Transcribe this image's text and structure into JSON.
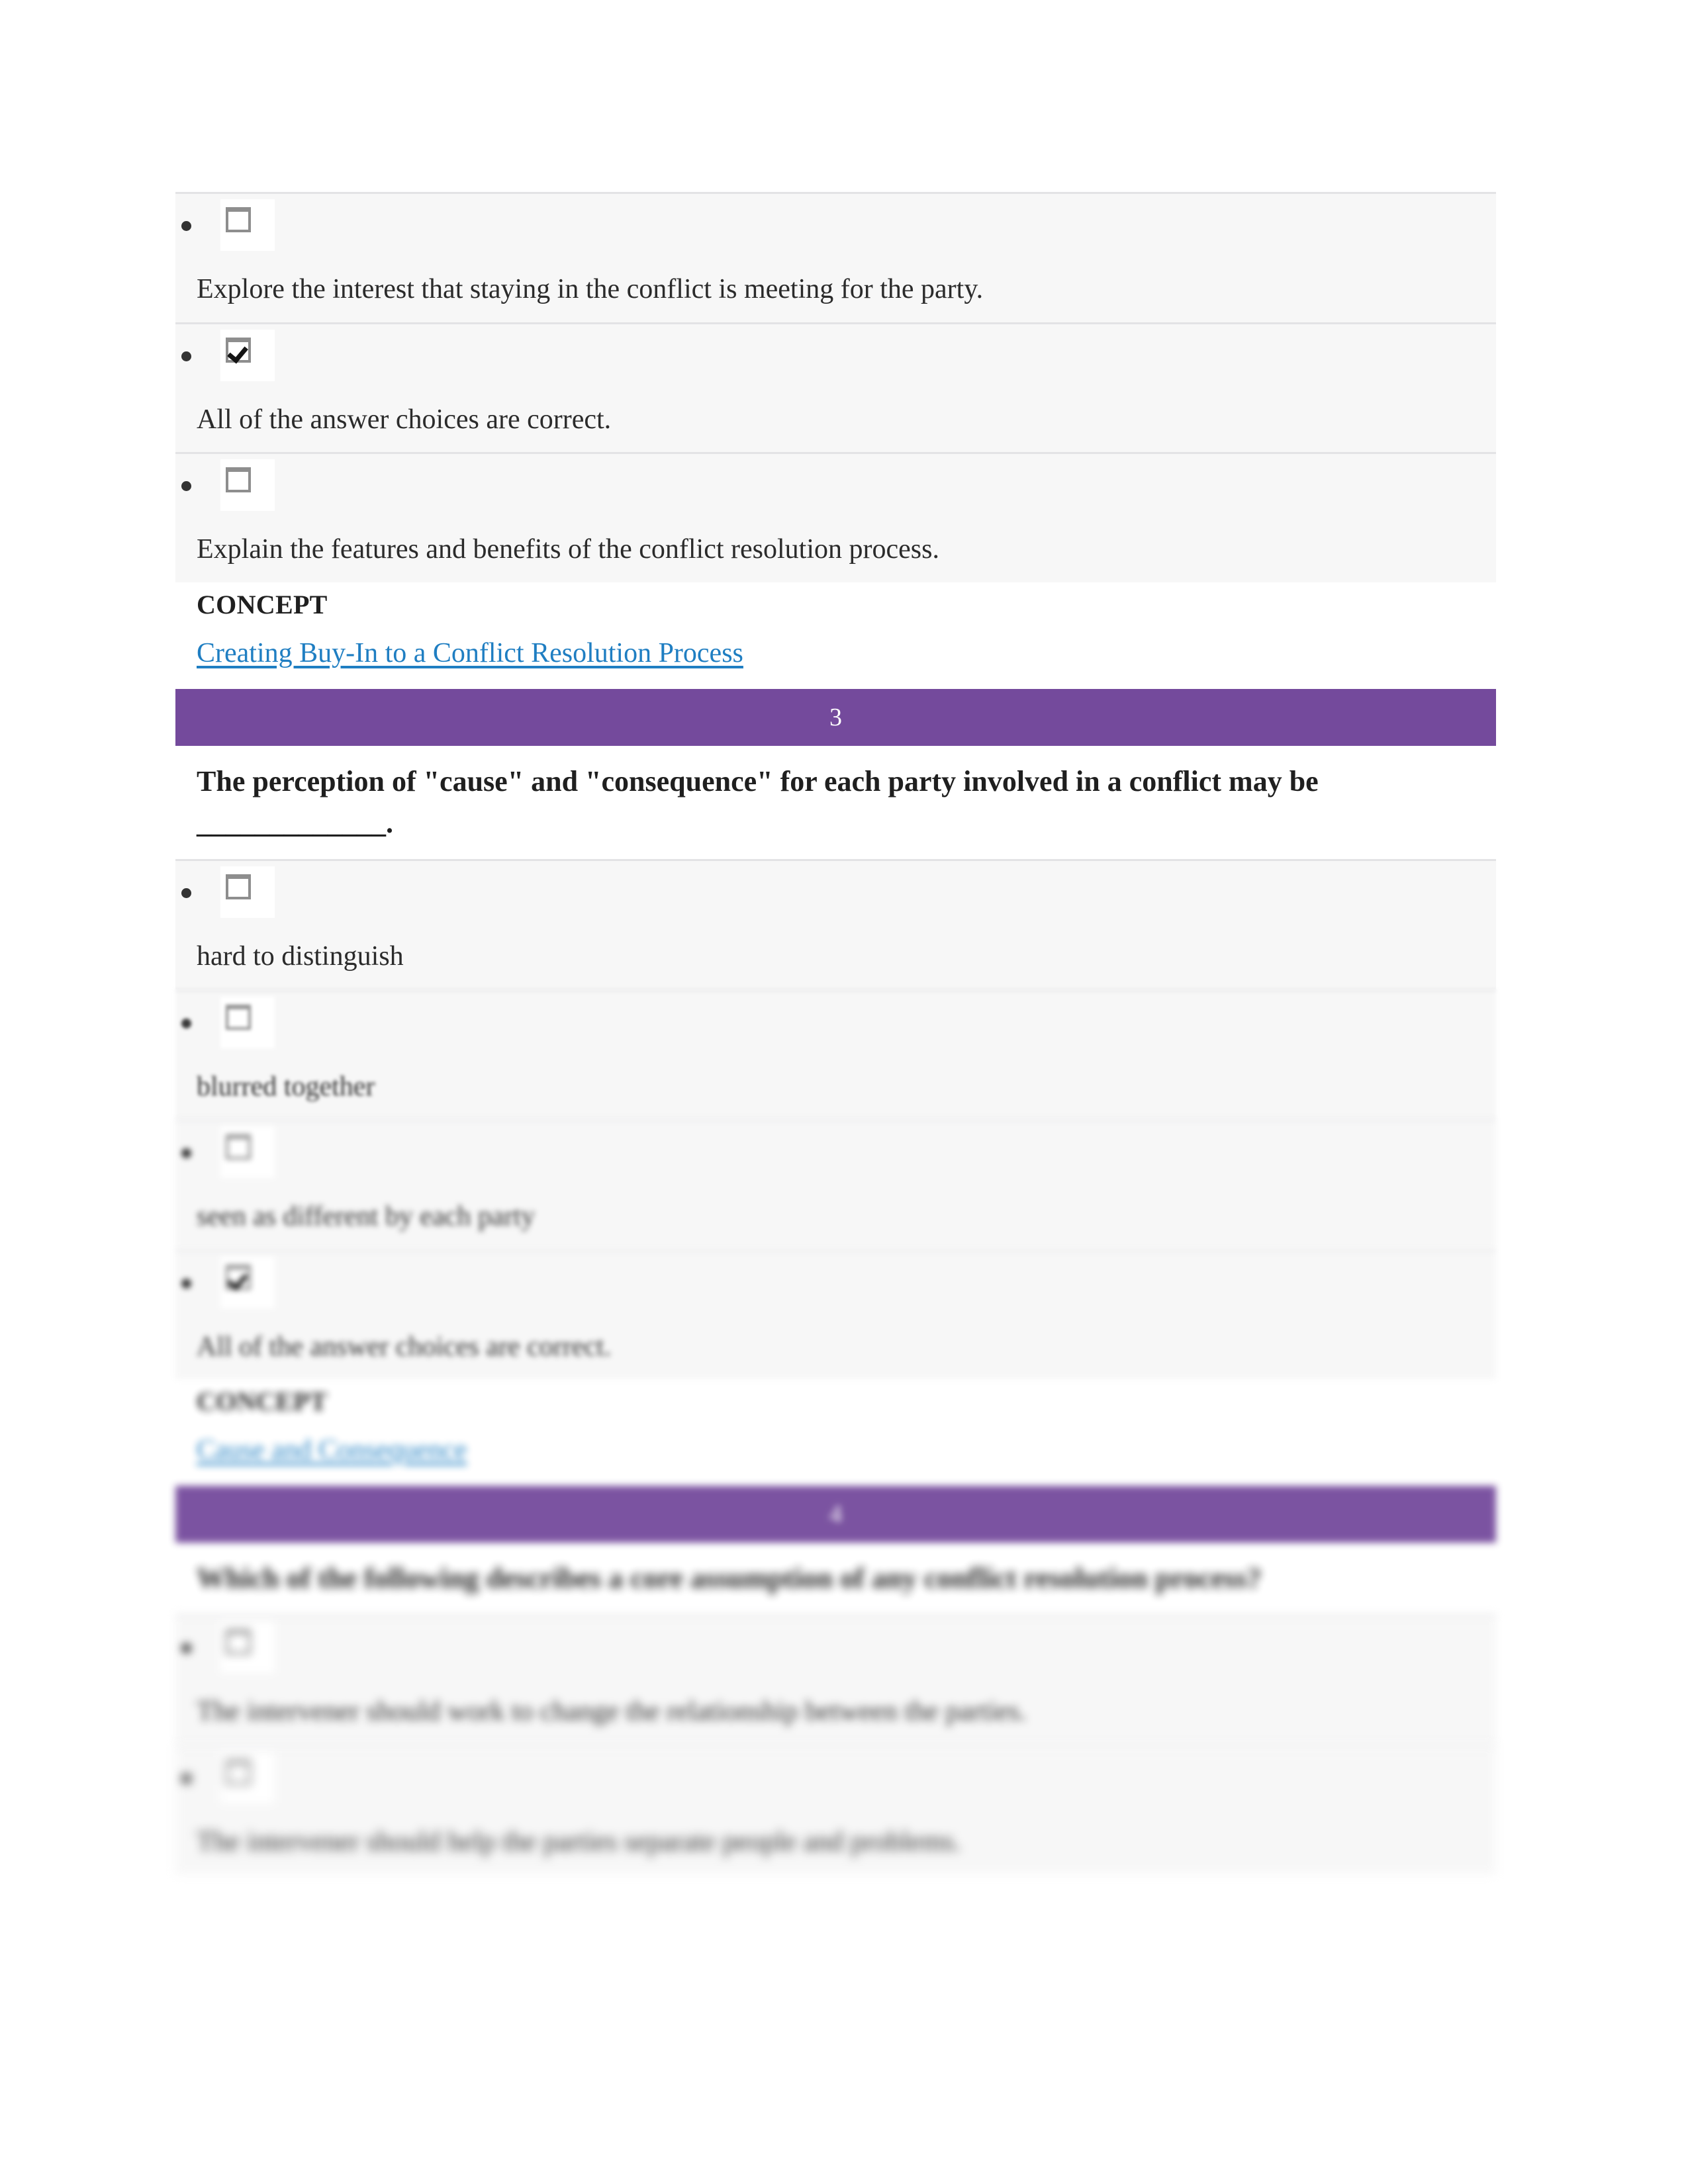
{
  "document": {
    "type": "quiz-review-page",
    "colors": {
      "banner_purple": "#744A9C",
      "link_blue": "#1F7EC2",
      "highlight_yellow": "#F2F20A",
      "option_row_gray": "#F7F7F7",
      "row_divider": "#E3E3E5",
      "text": "#2B2B2B"
    }
  },
  "question_2_tail": {
    "options": [
      {
        "label": "Explore the interest that staying in the conflict is meeting for the party.",
        "checked": false
      },
      {
        "label": "All of the answer choices are correct.",
        "checked": true
      },
      {
        "label": "Explain the features and benefits of the conflict resolution process.",
        "checked": false
      }
    ],
    "concept_heading": "CONCEPT",
    "concept_link": "Creating Buy-In to a Conflict Resolution Process"
  },
  "question_3": {
    "number": "3",
    "prompt": "The perception of \"cause\" and \"consequence\" for each party involved in a conflict may be _____________.",
    "options": [
      {
        "label": "hard to distinguish",
        "checked": false
      },
      {
        "label": "blurred together",
        "checked": false
      },
      {
        "label": "seen as different by each party",
        "checked": false
      },
      {
        "label": "All of the answer choices are correct.",
        "checked": true
      }
    ],
    "concept_heading": "CONCEPT",
    "concept_link": "Cause and Consequence"
  },
  "question_4": {
    "number": "4",
    "prompt": "Which of the following describes a core assumption of any conflict resolution process?",
    "options": [
      {
        "label": "The intervener should work to change the relationship between the parties.",
        "checked": false,
        "highlighted": false
      },
      {
        "label": "The intervener should help the parties separate people and problems.",
        "checked": false,
        "highlighted": true
      }
    ]
  }
}
